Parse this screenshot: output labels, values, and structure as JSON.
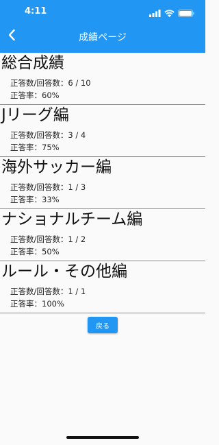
{
  "status_bar": {
    "time": "4:11",
    "icons": [
      "signal-icon",
      "wifi-icon",
      "battery-icon"
    ]
  },
  "app_bar": {
    "title": "成績ページ",
    "back_icon": "chevron-left-icon"
  },
  "sections": [
    {
      "title": "総合成績",
      "correct_label": "正答数/回答数：",
      "correct_value": "6 / 10",
      "rate_label": "正答率：",
      "rate_value": "60%"
    },
    {
      "title": "Jリーグ編",
      "correct_label": "正答数/回答数：",
      "correct_value": "3 / 4",
      "rate_label": "正答率：",
      "rate_value": "75%"
    },
    {
      "title": "海外サッカー編",
      "correct_label": "正答数/回答数：",
      "correct_value": "1 / 3",
      "rate_label": "正答率：",
      "rate_value": "33%"
    },
    {
      "title": "ナショナルチーム編",
      "correct_label": "正答数/回答数：",
      "correct_value": "1 / 2",
      "rate_label": "正答率：",
      "rate_value": "50%"
    },
    {
      "title": "ルール・その他編",
      "correct_label": "正答数/回答数：",
      "correct_value": "1 / 1",
      "rate_label": "正答率：",
      "rate_value": "100%"
    }
  ],
  "back_button_label": "戻る",
  "colors": {
    "primary": "#2196f3",
    "background": "#fafafa",
    "divider": "#8a8a8a"
  }
}
